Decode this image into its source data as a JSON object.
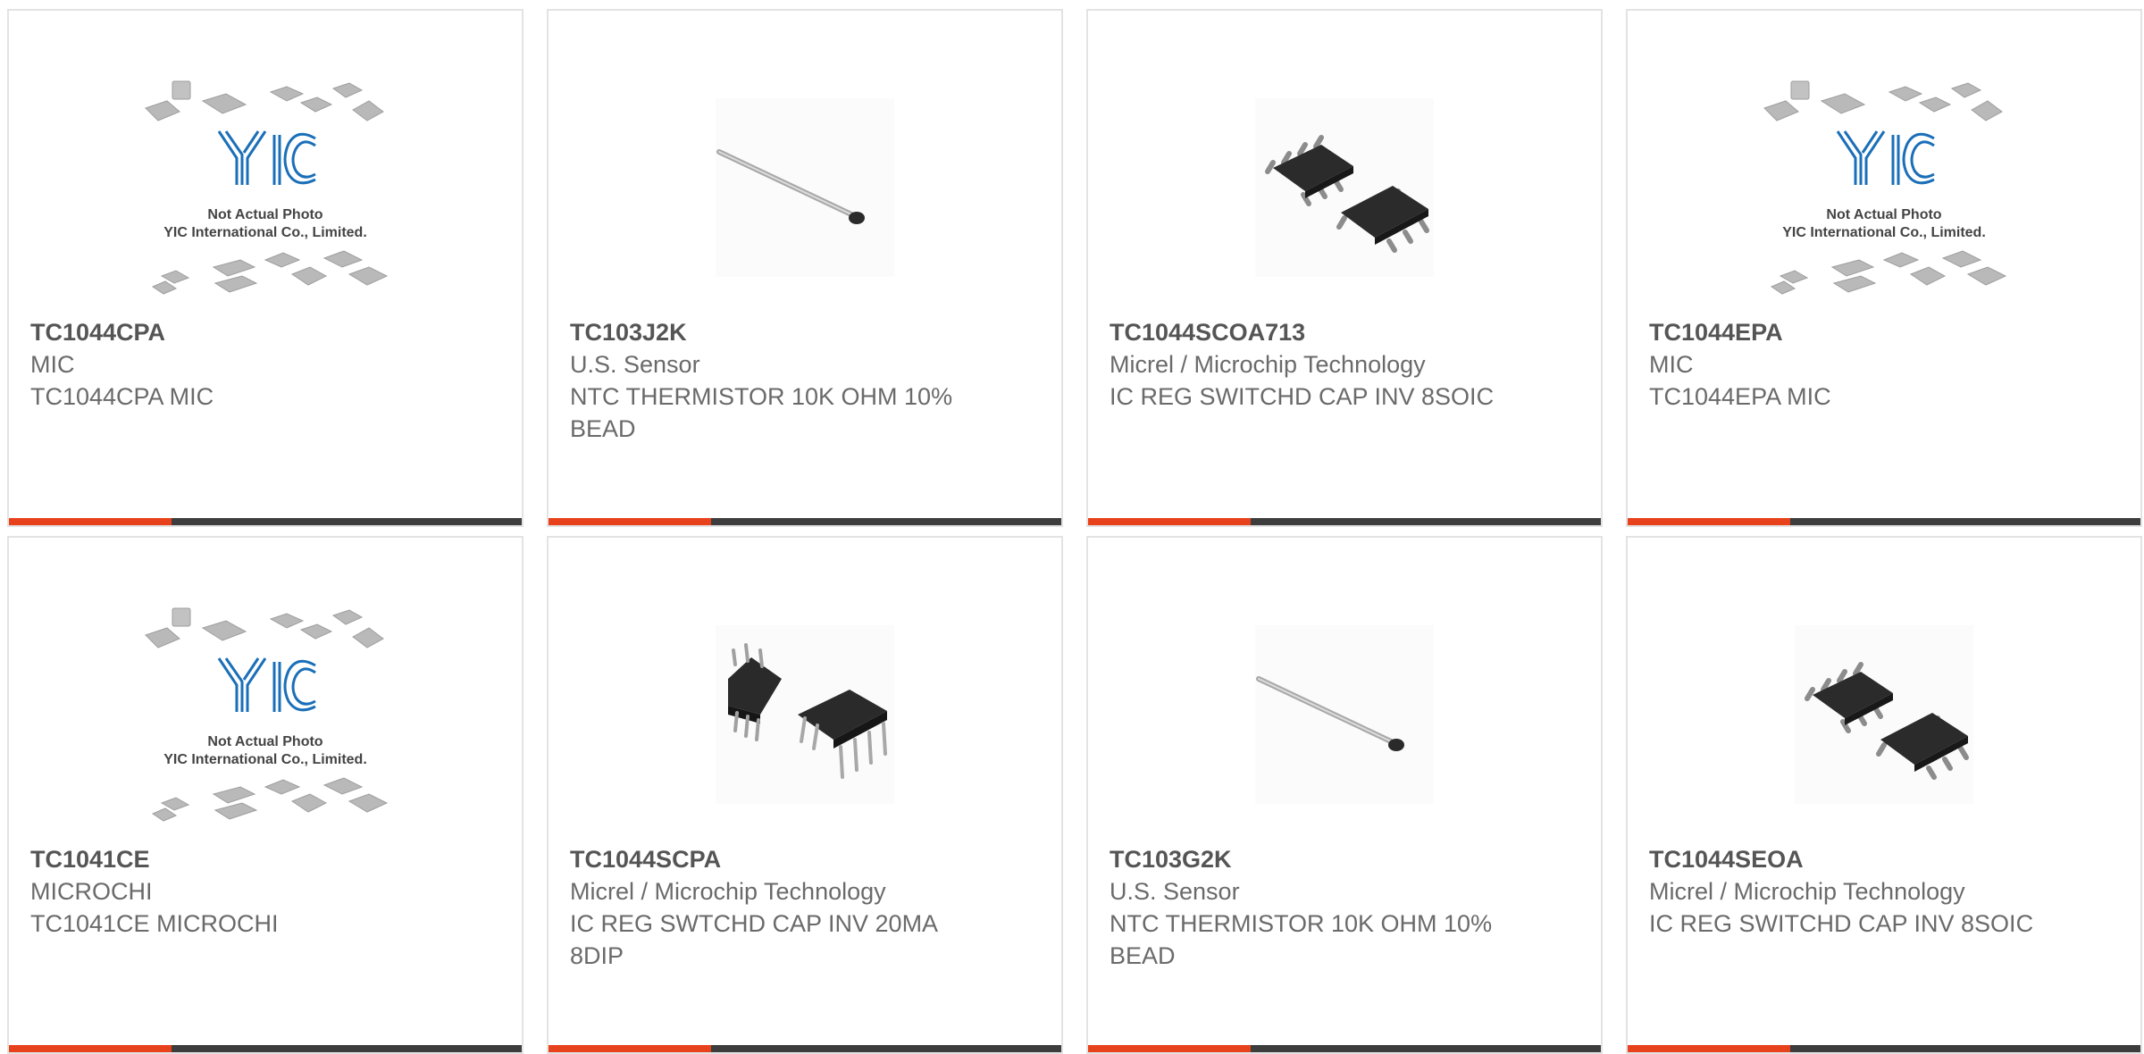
{
  "placeholder": {
    "line1": "Not Actual Photo",
    "line2": "YIC International Co., Limited.",
    "logo": "YIC"
  },
  "colors": {
    "accent": "#e8421c",
    "bar": "#3d3d3d",
    "logo_blue": "#1a6fb8"
  },
  "products": [
    {
      "part": "TC1044CPA",
      "mfr": "MIC",
      "desc": "TC1044CPA MIC",
      "image": "placeholder"
    },
    {
      "part": "TC103J2K",
      "mfr": "U.S. Sensor",
      "desc": "NTC THERMISTOR 10K OHM 10% BEAD",
      "image": "thermistor"
    },
    {
      "part": "TC1044SCOA713",
      "mfr": "Micrel / Microchip Technology",
      "desc": "IC REG SWITCHD CAP INV 8SOIC",
      "image": "soic"
    },
    {
      "part": "TC1044EPA",
      "mfr": "MIC",
      "desc": "TC1044EPA MIC",
      "image": "placeholder"
    },
    {
      "part": "TC1041CE",
      "mfr": "MICROCHI",
      "desc": "TC1041CE MICROCHI",
      "image": "placeholder"
    },
    {
      "part": "TC1044SCPA",
      "mfr": "Micrel / Microchip Technology",
      "desc": "IC REG SWTCHD CAP INV 20MA 8DIP",
      "image": "dip"
    },
    {
      "part": "TC103G2K",
      "mfr": "U.S. Sensor",
      "desc": "NTC THERMISTOR 10K OHM 10% BEAD",
      "image": "thermistor"
    },
    {
      "part": "TC1044SEOA",
      "mfr": "Micrel / Microchip Technology",
      "desc": "IC REG SWITCHD CAP INV 8SOIC",
      "image": "soic"
    }
  ]
}
